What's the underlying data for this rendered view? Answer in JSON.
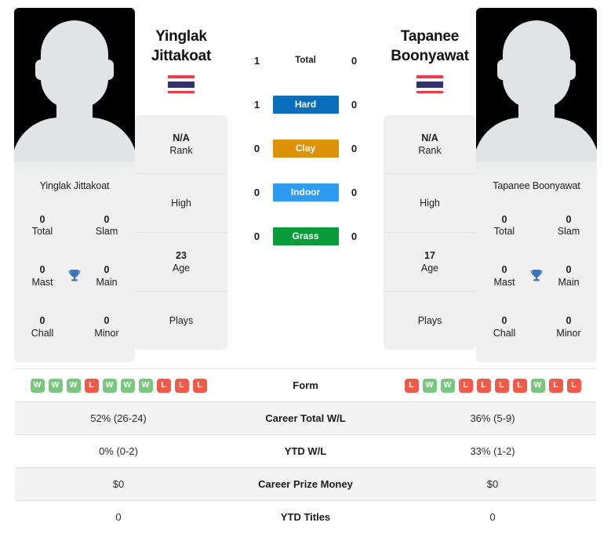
{
  "players": {
    "left": {
      "first_name": "Yinglak",
      "last_name": "Jittakoat",
      "full_name": "Yinglak Jittakoat",
      "country": "Thailand",
      "rank": "N/A",
      "rank_label": "Rank",
      "high_label": "High",
      "high_value": "",
      "age": "23",
      "age_label": "Age",
      "plays_label": "Plays",
      "plays_value": "",
      "titles": [
        {
          "value": "0",
          "label": "Total"
        },
        {
          "value": "0",
          "label": "Slam"
        },
        {
          "value": "0",
          "label": "Mast"
        },
        {
          "value": "0",
          "label": "Main"
        },
        {
          "value": "0",
          "label": "Chall"
        },
        {
          "value": "0",
          "label": "Minor"
        }
      ],
      "form": [
        "W",
        "W",
        "W",
        "L",
        "W",
        "W",
        "W",
        "L",
        "L",
        "L"
      ],
      "career_total_wl": "52% (26-24)",
      "ytd_wl": "0% (0-2)",
      "career_prize_money": "$0",
      "ytd_titles": "0"
    },
    "right": {
      "first_name": "Tapanee",
      "last_name": "Boonyawat",
      "full_name": "Tapanee Boonyawat",
      "country": "Thailand",
      "rank": "N/A",
      "rank_label": "Rank",
      "high_label": "High",
      "high_value": "",
      "age": "17",
      "age_label": "Age",
      "plays_label": "Plays",
      "plays_value": "",
      "titles": [
        {
          "value": "0",
          "label": "Total"
        },
        {
          "value": "0",
          "label": "Slam"
        },
        {
          "value": "0",
          "label": "Mast"
        },
        {
          "value": "0",
          "label": "Main"
        },
        {
          "value": "0",
          "label": "Chall"
        },
        {
          "value": "0",
          "label": "Minor"
        }
      ],
      "form": [
        "L",
        "W",
        "W",
        "L",
        "L",
        "L",
        "L",
        "W",
        "L",
        "L"
      ],
      "career_total_wl": "36% (5-9)",
      "ytd_wl": "33% (1-2)",
      "career_prize_money": "$0",
      "ytd_titles": "0"
    }
  },
  "head_to_head": [
    {
      "surface": "Total",
      "left_score": "1",
      "right_score": "0",
      "color": ""
    },
    {
      "surface": "Hard",
      "left_score": "1",
      "right_score": "0",
      "color": "#0a6ebd"
    },
    {
      "surface": "Clay",
      "left_score": "0",
      "right_score": "0",
      "color": "#dd9208"
    },
    {
      "surface": "Indoor",
      "left_score": "0",
      "right_score": "0",
      "color": "#2e9bf0"
    },
    {
      "surface": "Grass",
      "left_score": "0",
      "right_score": "0",
      "color": "#089b38"
    }
  ],
  "stats_rows": [
    {
      "label": "Form",
      "left": "",
      "right": ""
    },
    {
      "label": "Career Total W/L",
      "left": "52% (26-24)",
      "right": "36% (5-9)"
    },
    {
      "label": "YTD W/L",
      "left": "0% (0-2)",
      "right": "33% (1-2)"
    },
    {
      "label": "Career Prize Money",
      "left": "$0",
      "right": "$0"
    },
    {
      "label": "YTD Titles",
      "left": "0",
      "right": "0"
    }
  ],
  "colors": {
    "hard": "#0a6ebd",
    "clay": "#dd9208",
    "indoor": "#2e9bf0",
    "grass": "#089b38",
    "win_badge": "#79c67f",
    "loss_badge": "#ef5b48",
    "trophy": "#3f73b8",
    "card_bg": "#f0f0f0",
    "row_shade": "#f3f3f3"
  },
  "icons": {
    "avatar": "player-photo-placeholder",
    "trophy": "trophy-icon",
    "flag": "flag-thailand-icon"
  }
}
